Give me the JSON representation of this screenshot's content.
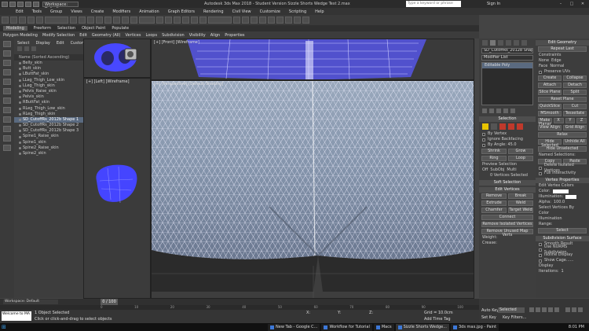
{
  "title_bar": {
    "workspace": "Workspace: Default",
    "title": "Autodesk 3ds Max 2018 - Student Version   Sizzle Shorts Wedge Test 2.max",
    "search_placeholder": "Type a keyword or phrase",
    "sign_in": "Sign In"
  },
  "menu": [
    "Edit",
    "Tools",
    "Group",
    "Views",
    "Create",
    "Modifiers",
    "Animation",
    "Graph Editors",
    "Rendering",
    "Civil View",
    "Customize",
    "Scripting",
    "Help"
  ],
  "ribbon": {
    "tabs": [
      "Modeling",
      "Freeform",
      "Selection",
      "Object Paint",
      "Populate"
    ],
    "items": [
      "Polygon Modeling",
      "Modify Selection",
      "Edit",
      "Geometry (All)",
      "Vertices",
      "Loops",
      "Subdivision",
      "Visibility",
      "Align",
      "Properties"
    ]
  },
  "scene_explorer": {
    "tabs": [
      "Select",
      "Display",
      "Edit",
      "Customize"
    ],
    "header": "Name (Sorted Ascending)",
    "items": [
      "Belly_skin",
      "Butt_skin",
      "LButtFat_skin",
      "LLeg_Thigh_Low_skin",
      "LLeg_Thigh_skin",
      "Pelvis_Raise_skin",
      "Pelvis_skin",
      "RButtFat_skin",
      "RLeg_Thigh_Low_skin",
      "RLeg_Thigh_skin",
      "SD_CutoffRs_2012b Shape 1",
      "SD_CutoffRs_2012b Shape 2",
      "SD_CutoffRs_2012b Shape 3",
      "Spine1_Raise_skin",
      "Spine1_skin",
      "Spine2_Raise_skin",
      "Spine2_skin"
    ],
    "selected_index": 10
  },
  "viewports": {
    "top_left": "[+] [Top] [Wireframe]",
    "top_main": "[+] [Front] [Wireframe]",
    "left": "[+] [Left] [Wireframe]",
    "main": "[+] [Perspective] [Default Shading]"
  },
  "command_panel": {
    "object_name": "SD_CutoffRs_2012b Shape 1",
    "modifier_list": "Modifier List",
    "stack_item": "Editable Poly",
    "selection_title": "Selection",
    "selection_items": [
      "By Vertex",
      "Ignore Backfacing",
      "By Angle: 45.0",
      "Shrink",
      "Grow",
      "Ring",
      "Loop"
    ],
    "preview_label": "Preview Selection",
    "preview_options": [
      "Off",
      "SubObj",
      "Multi"
    ],
    "selected_count": "0 Vertices Selected",
    "soft_selection": "Soft Selection",
    "edit_vertices": "Edit Vertices",
    "edit_buttons": [
      "Remove",
      "Break",
      "Extrude",
      "Weld",
      "Chamfer",
      "Target Weld",
      "Connect"
    ],
    "remove_isolated": "Remove Isolated Vertices",
    "remove_unused": "Remove Unused Map Verts",
    "weight": "Weight:",
    "crease": "Crease:"
  },
  "edit_geometry": {
    "title": "Edit Geometry",
    "repeat_last": "Repeat Last",
    "constraints": "Constraints",
    "constraint_opts": [
      "None",
      "Edge",
      "Face",
      "Normal"
    ],
    "preserve_uvs": "Preserve UVs",
    "buttons": [
      "Create",
      "Collapse",
      "Attach",
      "Detach",
      "Slice Plane",
      "Split",
      "Reset Plane",
      "QuickSlice",
      "Cut",
      "MSmooth",
      "Tessellate",
      "Make Planar",
      "X",
      "Y",
      "Z",
      "View Align",
      "Grid Align",
      "Relax",
      "Hide Selected",
      "Unhide All",
      "Hide Unselected",
      "Copy",
      "Paste",
      "Delete Isolated Vertices",
      "Full Interactivity"
    ],
    "named_selections": "Named Selections:",
    "vertex_props": "Vertex Properties",
    "edit_vertex_colors": "Edit Vertex Colors",
    "color": "Color:",
    "illumination": "Illumination:",
    "alpha": "Alpha:",
    "alpha_value": "100.0",
    "select_vertices_by": "Select Vertices By",
    "vb_color": "Color",
    "vb_illum": "Illumination",
    "range": "Range:",
    "select": "Select",
    "subdivision_surface": "Subdivision Surface",
    "smooth_result": "Smooth Result",
    "use_nurms": "Use NURMS Subdivision",
    "isoline": "Isoline Display",
    "show_cage": "Show Cage......",
    "display": "Display",
    "iterations": "Iterations:",
    "iterations_value": "1"
  },
  "timeline": {
    "frame": "0 / 100",
    "ticks": [
      "0",
      "5",
      "10",
      "15",
      "20",
      "25",
      "30",
      "35",
      "40",
      "45",
      "50",
      "55",
      "60",
      "65",
      "70",
      "75",
      "80",
      "85",
      "90",
      "95",
      "100"
    ]
  },
  "status": {
    "workspace": "Workspace: Default",
    "objects": "1 Object Selected",
    "prompt": "Click or click-and-drag to select objects",
    "maxscript": "Welcome to MA",
    "x": "X:",
    "y": "Y:",
    "z": "Z:",
    "grid": "Grid = 10.0cm",
    "add_time_tag": "Add Time Tag",
    "auto_key": "Auto Key",
    "set_key": "Set Key",
    "selected": "Selected",
    "key_filters": "Key Filters..."
  },
  "taskbar": {
    "tasks": [
      "New Tab - Google C...",
      "Workflow for Tutorial",
      "Macs",
      "Sizzle Shorts Wedge...",
      "3ds max.jpg - Paint"
    ],
    "time": "8:01 PM"
  },
  "colors": {
    "wire": "#4f4fff",
    "selection_bg": "#5a6a80",
    "accent_red": "#c0392b",
    "accent_yellow": "#e8c400"
  }
}
